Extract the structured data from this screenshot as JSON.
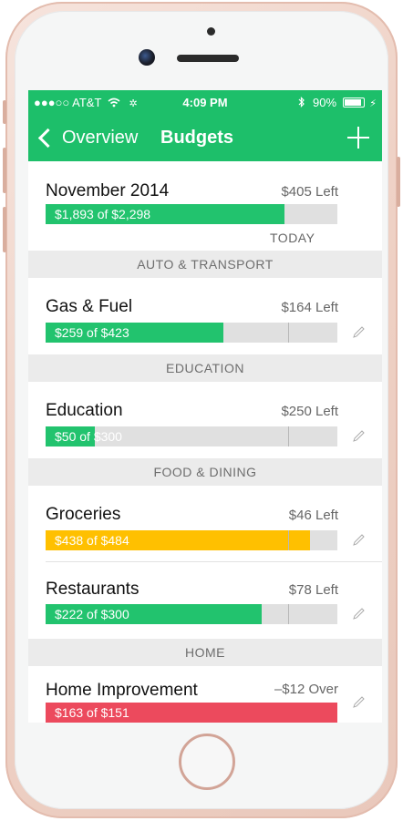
{
  "colors": {
    "accent": "#1dbf6a",
    "green_bar": "#22c36e",
    "yellow_bar": "#ffc000",
    "red_bar": "#ec4a5d"
  },
  "status_bar": {
    "carrier": "●●●○○ AT&T",
    "time": "4:09 PM",
    "battery": "90%"
  },
  "nav": {
    "back_label": "Overview",
    "title": "Budgets"
  },
  "summary": {
    "name": "November 2014",
    "left": "$405 Left",
    "bar_text": "$1,893 of $2,298",
    "progress": 0.82,
    "today_label": "TODAY"
  },
  "sections": [
    {
      "header": "AUTO & TRANSPORT",
      "items": [
        {
          "name": "Gas & Fuel",
          "left": "$164 Left",
          "bar_text": "$259 of $423",
          "progress": 0.61,
          "status": "green"
        }
      ]
    },
    {
      "header": "EDUCATION",
      "items": [
        {
          "name": "Education",
          "left": "$250 Left",
          "bar_text": "$50 of $300",
          "progress": 0.17,
          "status": "green"
        }
      ]
    },
    {
      "header": "FOOD & DINING",
      "items": [
        {
          "name": "Groceries",
          "left": "$46 Left",
          "bar_text": "$438 of $484",
          "progress": 0.905,
          "status": "yellow"
        },
        {
          "name": "Restaurants",
          "left": "$78 Left",
          "bar_text": "$222 of $300",
          "progress": 0.74,
          "status": "green"
        }
      ]
    },
    {
      "header": "HOME",
      "items": [
        {
          "name": "Home Improvement",
          "left": "–$12 Over",
          "bar_text": "$163 of $151",
          "progress": 1.0,
          "status": "red"
        }
      ]
    }
  ],
  "icons": {
    "pencil": "pencil-icon",
    "add": "plus-icon",
    "back": "chevron-left-icon",
    "wifi": "wifi-icon",
    "bluetooth": "bluetooth-icon"
  }
}
